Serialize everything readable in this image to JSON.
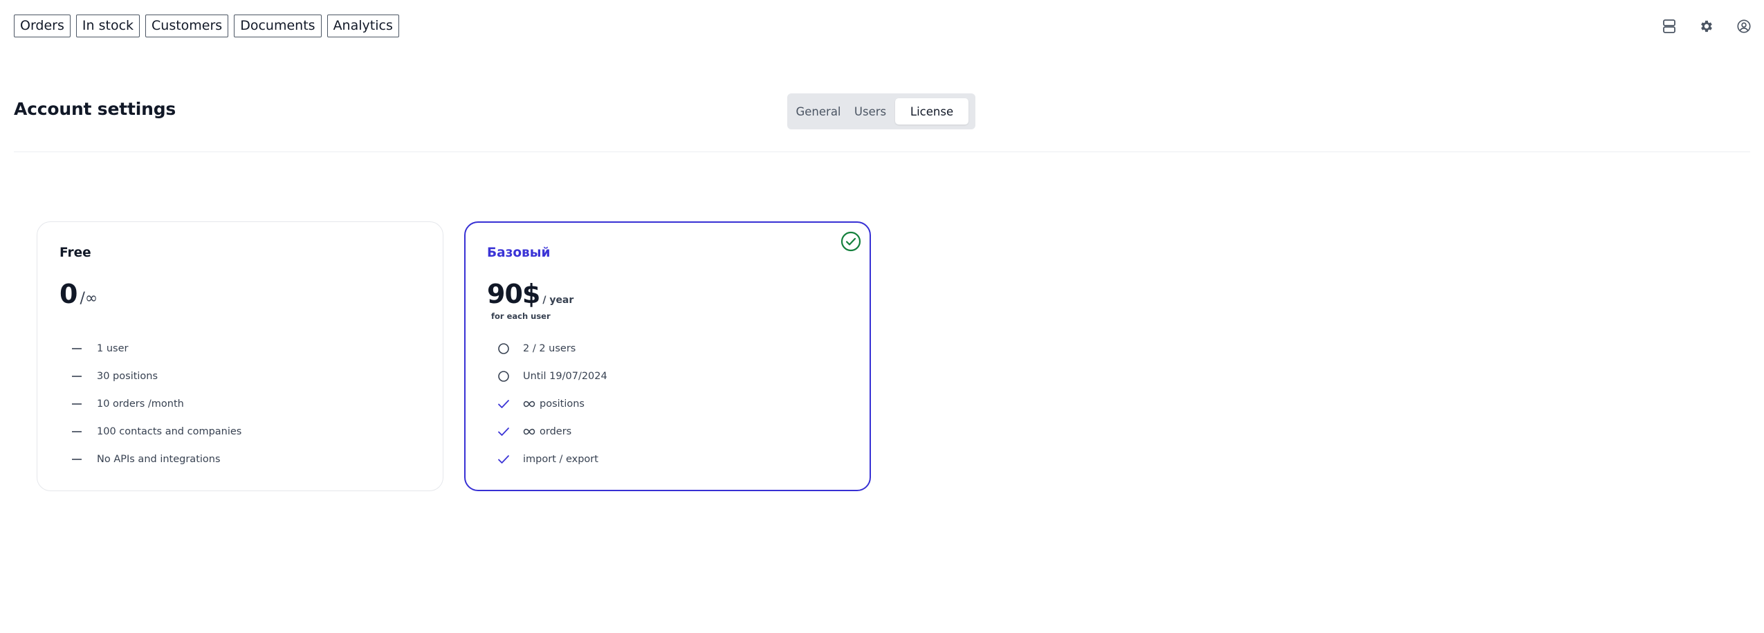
{
  "nav": {
    "items": [
      "Orders",
      "In stock",
      "Customers",
      "Documents",
      "Analytics"
    ]
  },
  "top_icons": [
    "layout-icon",
    "gear-icon",
    "user-circle-icon"
  ],
  "header": {
    "title": "Account settings",
    "tabs": [
      "General",
      "Users",
      "License"
    ],
    "active_tab": "License"
  },
  "plans": {
    "free": {
      "name": "Free",
      "price": "0",
      "period": "/∞",
      "features": [
        "1 user",
        "30 positions",
        "10 orders /month",
        "100 contacts and companies",
        "No APIs and integrations"
      ]
    },
    "basic": {
      "name": "Базовый",
      "price": "90$",
      "period": "/ year",
      "price_note": "for each user",
      "selected": true,
      "features": [
        {
          "icon": "circle-icon",
          "text": "2 / 2 users"
        },
        {
          "icon": "circle-icon",
          "text": "Until 19/07/2024"
        },
        {
          "icon": "check-icon",
          "prefix_icon": "infinity-icon",
          "text": "positions"
        },
        {
          "icon": "check-icon",
          "prefix_icon": "infinity-icon",
          "text": "orders"
        },
        {
          "icon": "check-icon",
          "text": "import / export"
        }
      ]
    }
  },
  "colors": {
    "accent": "#3b34d6",
    "selected_badge": "#15803d",
    "text": "#111827",
    "muted": "#374151"
  }
}
